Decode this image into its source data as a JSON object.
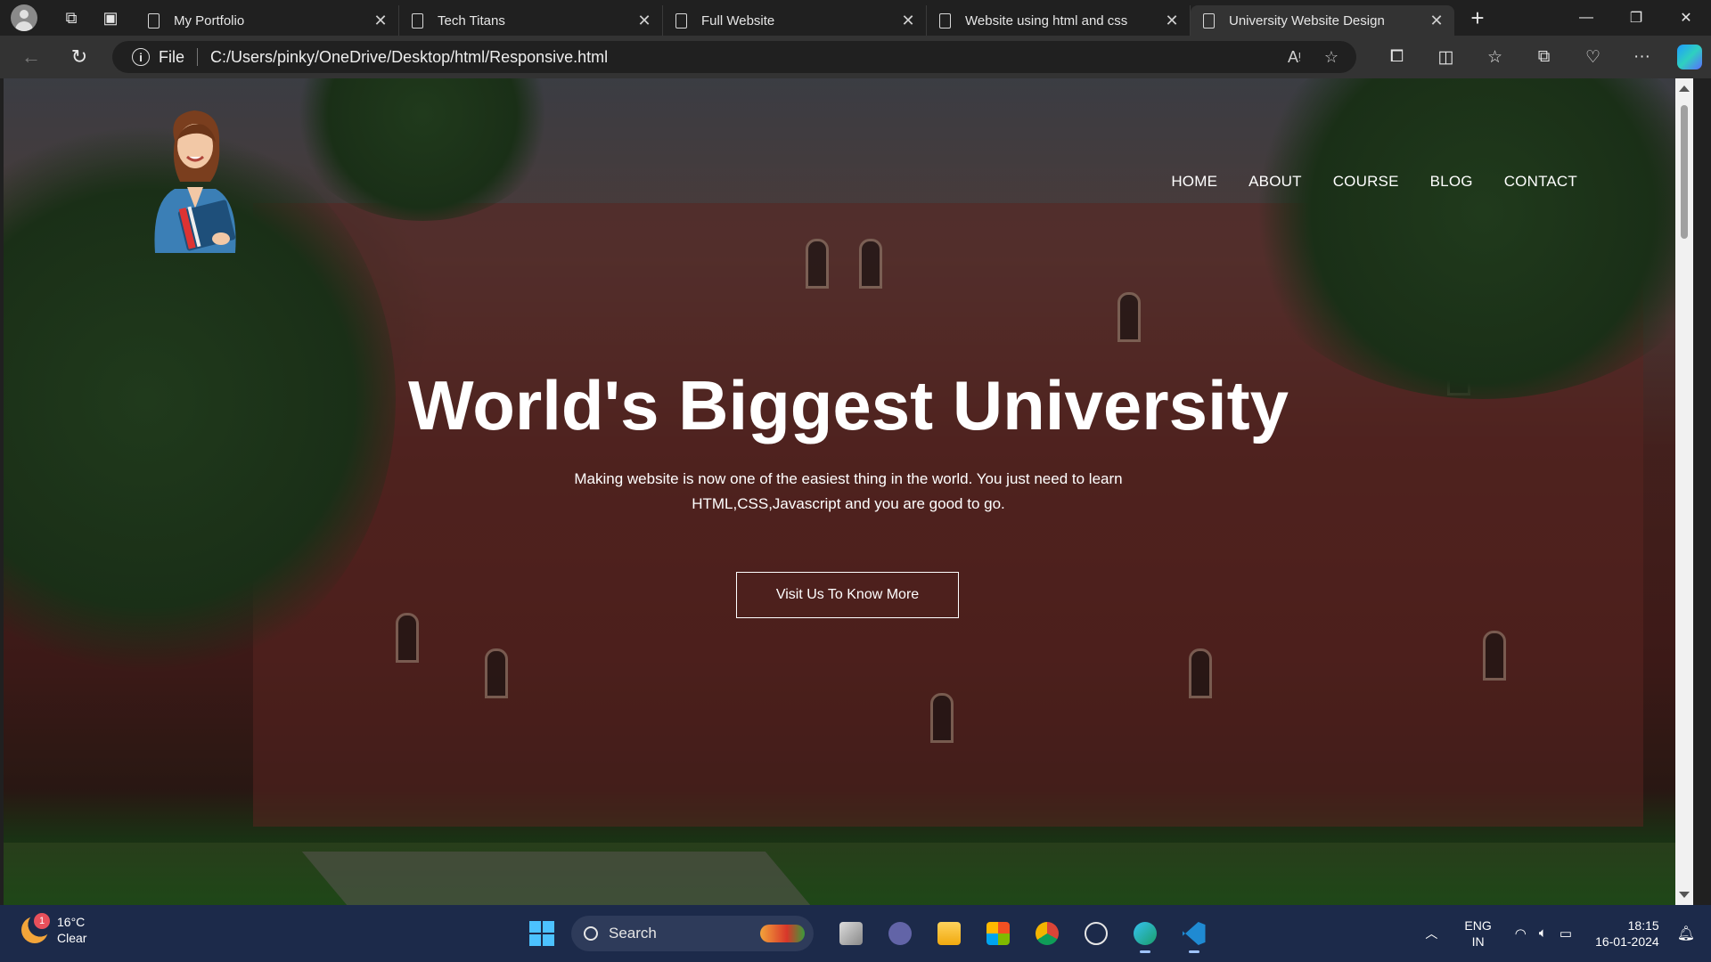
{
  "browser": {
    "tabs": [
      {
        "title": "My Portfolio",
        "active": false
      },
      {
        "title": "Tech Titans",
        "active": false
      },
      {
        "title": "Full Website",
        "active": false
      },
      {
        "title": "Website using html and css",
        "active": false
      },
      {
        "title": "University Website Design",
        "active": true
      }
    ],
    "address": {
      "scheme_label": "File",
      "url": "C:/Users/pinky/OneDrive/Desktop/html/Responsive.html"
    }
  },
  "page": {
    "nav": [
      "HOME",
      "ABOUT",
      "COURSE",
      "BLOG",
      "CONTACT"
    ],
    "hero": {
      "title": "World's Biggest University",
      "text": "Making website is now one of the easiest thing in the world. You just need to learn HTML,CSS,Javascript and you are good to go.",
      "cta": "Visit Us To Know More"
    }
  },
  "taskbar": {
    "weather": {
      "temp": "16°C",
      "condition": "Clear",
      "badge": "1"
    },
    "search_placeholder": "Search",
    "lang": {
      "line1": "ENG",
      "line2": "IN"
    },
    "clock": {
      "time": "18:15",
      "date": "16-01-2024"
    },
    "pinned_icons": [
      "start-icon",
      "search",
      "task-view-icon",
      "teams-icon",
      "file-explorer-icon",
      "store-icon",
      "chrome-icon",
      "dell-icon",
      "edge-icon",
      "vscode-icon"
    ]
  }
}
